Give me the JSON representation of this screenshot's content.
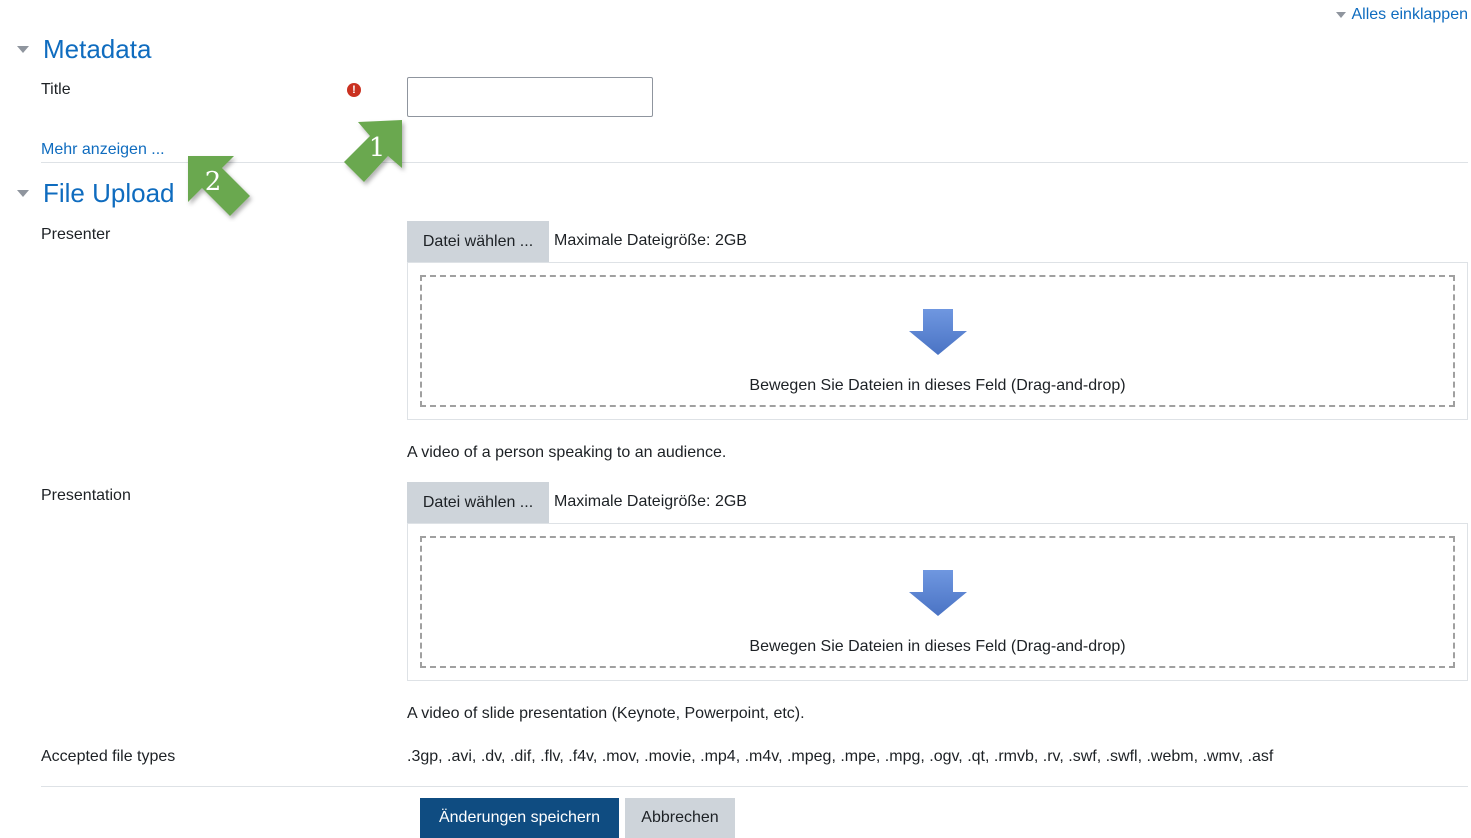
{
  "header": {
    "collapse_all_label": "Alles einklappen"
  },
  "metadata": {
    "section_title": "Metadata",
    "title_label": "Title",
    "title_value": "",
    "show_more_label": "Mehr anzeigen ..."
  },
  "file_upload": {
    "section_title": "File Upload",
    "presenter": {
      "label": "Presenter",
      "choose_file_label": "Datei wählen ...",
      "max_size_text": "Maximale Dateigröße: 2GB",
      "drop_text": "Bewegen Sie Dateien in dieses Feld (Drag-and-drop)",
      "help_text": "A video of a person speaking to an audience."
    },
    "presentation": {
      "label": "Presentation",
      "choose_file_label": "Datei wählen ...",
      "max_size_text": "Maximale Dateigröße: 2GB",
      "drop_text": "Bewegen Sie Dateien in dieses Feld (Drag-and-drop)",
      "help_text": "A video of slide presentation (Keynote, Powerpoint, etc)."
    },
    "accepted_types_label": "Accepted file types",
    "accepted_types_value": ".3gp, .avi, .dv, .dif, .flv, .f4v, .mov, .movie, .mp4, .m4v, .mpeg, .mpe, .mpg, .ogv, .qt, .rmvb, .rv, .swf, .swfl, .webm, .wmv, .asf"
  },
  "actions": {
    "save_label": "Änderungen speichern",
    "cancel_label": "Abbrechen"
  },
  "callouts": [
    {
      "number": "1"
    },
    {
      "number": "2"
    }
  ],
  "colors": {
    "link": "#0f6cbf",
    "primary_button": "#0f4c81",
    "required_icon": "#ca3120",
    "callout_green": "#6aa84f",
    "drop_arrow": "#5b85d6"
  }
}
